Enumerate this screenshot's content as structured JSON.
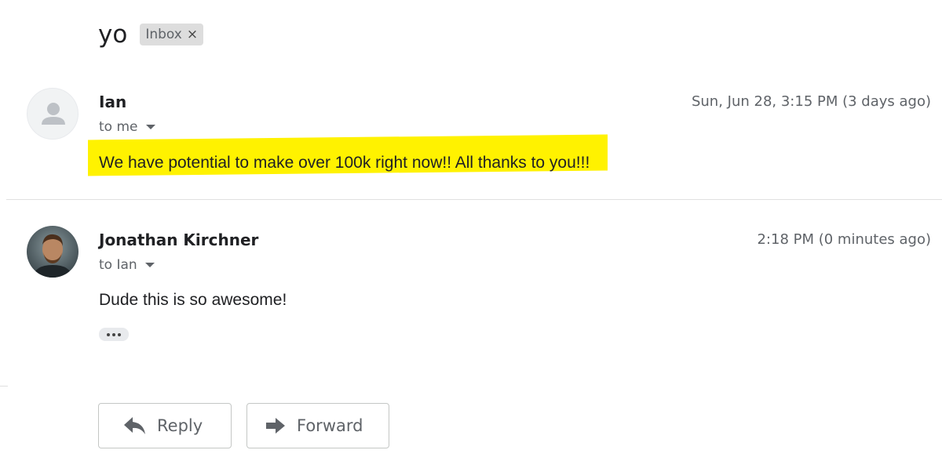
{
  "thread": {
    "subject": "yo",
    "label": "Inbox",
    "label_remove": "×"
  },
  "messages": [
    {
      "sender": "Ian",
      "recipient": "to me",
      "timestamp": "Sun, Jun 28, 3:15 PM (3 days ago)",
      "body": "We have potential to make over 100k right now!! All thanks to you!!!",
      "avatar": "default-person-icon",
      "highlight_color": "#fff200"
    },
    {
      "sender": "Jonathan Kirchner",
      "recipient": "to Ian",
      "timestamp": "2:18 PM (0 minutes ago)",
      "body": "Dude this is so awesome!",
      "avatar": "profile-photo"
    }
  ],
  "actions": {
    "reply_label": "Reply",
    "forward_label": "Forward",
    "reply_icon": "reply-arrow-icon",
    "forward_icon": "forward-arrow-icon",
    "more_icon": "ellipsis-icon"
  }
}
